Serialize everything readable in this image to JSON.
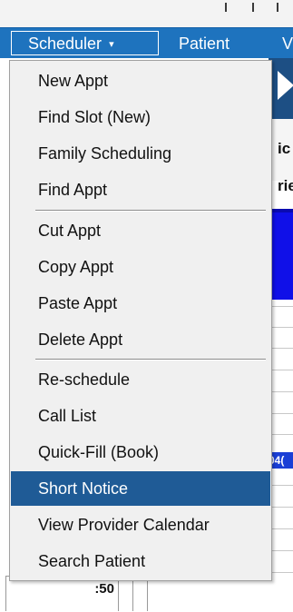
{
  "menubar": {
    "scheduler_label": "Scheduler",
    "scheduler_caret": "▾",
    "patient_label": "Patient",
    "third_partial": "V"
  },
  "background": {
    "partial_text_1": "ic",
    "partial_text_2": "rie",
    "partial_cell": "04(",
    "time_label": ":50"
  },
  "dropdown": {
    "groups": [
      [
        "New Appt",
        "Find Slot (New)",
        "Family Scheduling",
        "Find Appt"
      ],
      [
        "Cut Appt",
        "Copy Appt",
        "Paste Appt",
        "Delete Appt"
      ],
      [
        "Re-schedule",
        "Call List",
        "Quick-Fill (Book)",
        "Short Notice",
        "View Provider Calendar",
        "Search Patient"
      ]
    ],
    "selected": "Short Notice"
  },
  "colors": {
    "menubar_bg": "#1e73be",
    "selected_bg": "#1f5b96",
    "menu_bg": "#f0f0f0"
  }
}
